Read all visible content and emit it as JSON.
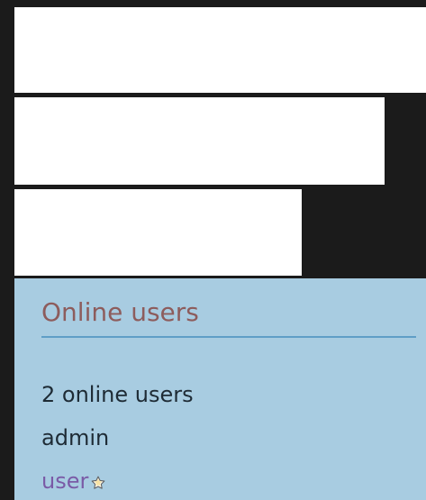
{
  "online_users": {
    "title": "Online users",
    "count_text": "2 online users",
    "users": [
      {
        "name": "admin",
        "icon": ""
      },
      {
        "name": "user",
        "icon": "star-icon"
      }
    ]
  },
  "colors": {
    "background": "#1b1b1b",
    "panel": "#ffffff",
    "online_panel": "#a8cce1",
    "title": "#8d5c5c",
    "divider": "#5f9ec6",
    "text": "#1e2b35",
    "link": "#7a5aa6"
  }
}
